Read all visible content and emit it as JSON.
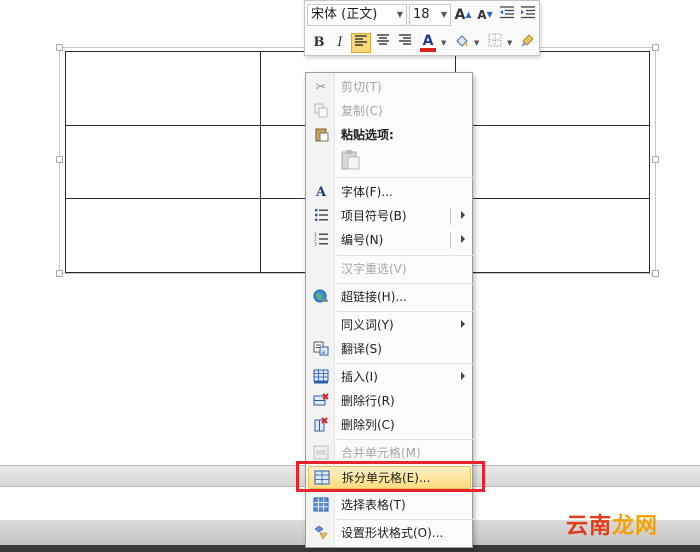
{
  "toolbar": {
    "font_name": "宋体 (正文)",
    "font_size": "18",
    "bold_label": "B",
    "italic_label": "I",
    "grow_font_label": "A",
    "shrink_font_label": "A",
    "font_color_label": "A",
    "font_color": "#e02020",
    "highlight_color": "#ffff00"
  },
  "context_menu": {
    "cut": "剪切(T)",
    "copy": "复制(C)",
    "paste_options": "粘贴选项:",
    "font": "字体(F)...",
    "bullets": "项目符号(B)",
    "numbering": "编号(N)",
    "hanzi_reconvert": "汉字重选(V)",
    "hyperlink": "超链接(H)...",
    "synonyms": "同义词(Y)",
    "translate": "翻译(S)",
    "insert": "插入(I)",
    "delete_row": "删除行(R)",
    "delete_column": "删除列(C)",
    "merge_cells": "合并单元格(M)",
    "split_cells": "拆分单元格(E)...",
    "select_table": "选择表格(T)",
    "format_shape": "设置形状格式(O)..."
  },
  "watermark": {
    "part1": "云南",
    "part2": "龙网"
  },
  "colors": {
    "highlight_box": "#e8242a",
    "hover_item": "#fbdc7e",
    "disabled_text": "#a6a6a6"
  }
}
